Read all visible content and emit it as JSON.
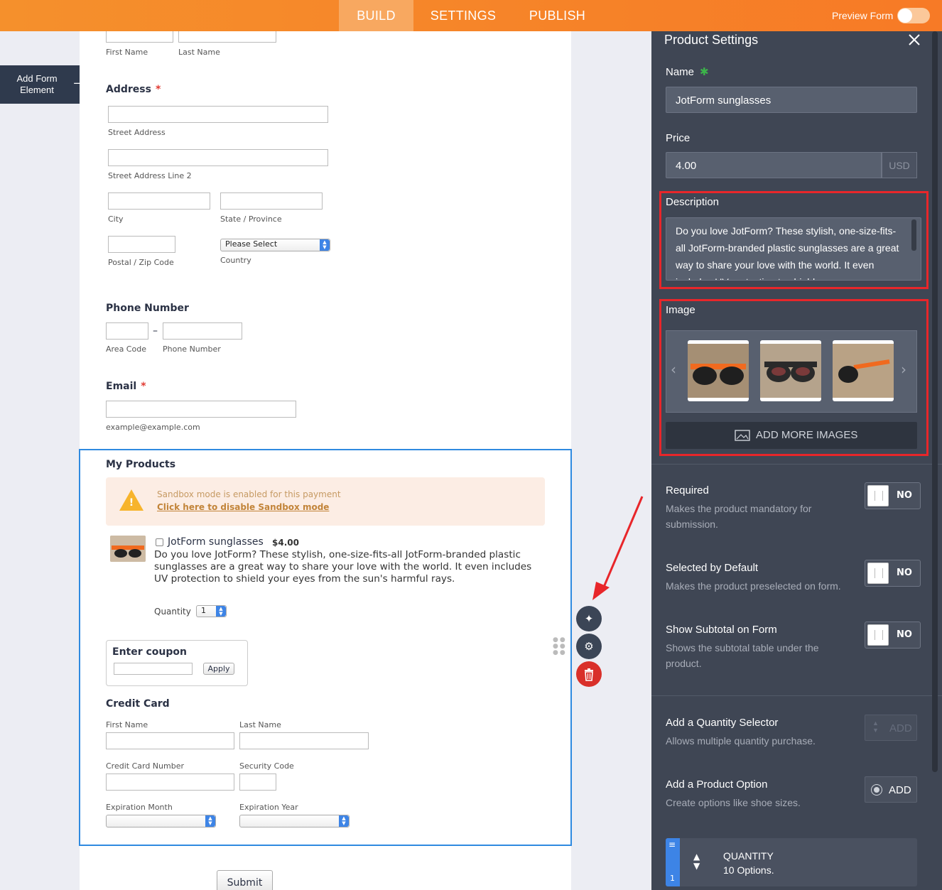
{
  "header": {
    "tabs": [
      "BUILD",
      "SETTINGS",
      "PUBLISH"
    ],
    "preview_label": "Preview Form"
  },
  "left": {
    "add_element_label": "Add Form Element"
  },
  "form": {
    "name": {
      "first": "First Name",
      "last": "Last Name"
    },
    "address": {
      "title": "Address",
      "street": "Street Address",
      "street2": "Street Address Line 2",
      "city": "City",
      "state": "State / Province",
      "zip": "Postal / Zip Code",
      "country_select": "Please Select",
      "country": "Country"
    },
    "phone": {
      "title": "Phone Number",
      "area": "Area Code",
      "number": "Phone Number"
    },
    "email": {
      "title": "Email",
      "hint": "example@example.com"
    },
    "products": {
      "title": "My Products",
      "sandbox_text": "Sandbox mode is enabled for this payment",
      "sandbox_link": "Click here to disable Sandbox mode",
      "product_name": "JotForm sunglasses",
      "product_price": "$4.00",
      "product_desc": "Do you love JotForm? These stylish, one-size-fits-all JotForm-branded plastic sunglasses are a great way to share your love with the world. It even includes UV protection to shield your eyes from the sun's harmful rays.",
      "quantity_label": "Quantity",
      "quantity_value": "1"
    },
    "coupon": {
      "title": "Enter coupon",
      "apply": "Apply"
    },
    "credit_card": {
      "title": "Credit Card",
      "first": "First Name",
      "last": "Last Name",
      "number": "Credit Card Number",
      "security": "Security Code",
      "exp_month": "Expiration Month",
      "exp_year": "Expiration Year"
    },
    "submit": "Submit"
  },
  "panel": {
    "title": "Product Settings",
    "name_label": "Name",
    "name_value": "JotForm sunglasses",
    "price_label": "Price",
    "price_value": "4.00",
    "currency": "USD",
    "description_label": "Description",
    "description_value": "Do you love JotForm? These stylish, one-size-fits-all JotForm-branded plastic sunglasses are a great way to share your love with the world. It even includes UV protection to shield your eyes",
    "image_label": "Image",
    "add_images": "ADD MORE IMAGES",
    "required": {
      "label": "Required",
      "desc": "Makes the product mandatory for submission.",
      "state": "NO"
    },
    "selected_default": {
      "label": "Selected by Default",
      "desc": "Makes the product preselected on form.",
      "state": "NO"
    },
    "show_subtotal": {
      "label": "Show Subtotal on Form",
      "desc": "Shows the subtotal table under the product.",
      "state": "NO"
    },
    "quantity_selector": {
      "label": "Add a Quantity Selector",
      "desc": "Allows multiple quantity purchase.",
      "button": "ADD"
    },
    "product_option": {
      "label": "Add a Product Option",
      "desc": "Create options like shoe sizes.",
      "button": "ADD"
    },
    "option_card": {
      "index": "1",
      "title": "QUANTITY",
      "subtitle": "10 Options."
    }
  },
  "colors": {
    "accent_orange": "#f7852a",
    "panel_bg": "#3f4654",
    "highlight_red": "#e8262a",
    "selection_blue": "#2f8ae0"
  }
}
